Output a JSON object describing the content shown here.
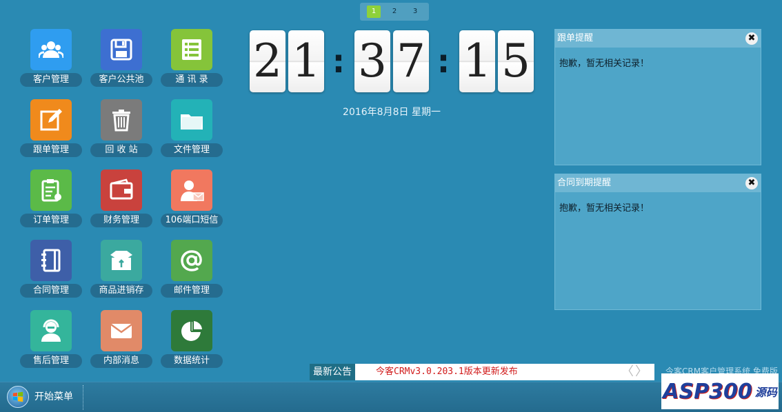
{
  "pager": {
    "pages": [
      "1",
      "2",
      "3"
    ],
    "active": 0
  },
  "desktop": {
    "icons": [
      {
        "label": "客户管理",
        "icon": "users-icon",
        "color": "#2f9df0"
      },
      {
        "label": "客户公共池",
        "icon": "floppy-disk-icon",
        "color": "#3d6fd1"
      },
      {
        "label": "通 讯 录",
        "icon": "list-icon",
        "color": "#85c43a"
      },
      {
        "label": "跟单管理",
        "icon": "edit-icon",
        "color": "#f08a1c"
      },
      {
        "label": "回 收 站",
        "icon": "trash-icon",
        "color": "#7b7b7b"
      },
      {
        "label": "文件管理",
        "icon": "folder-icon",
        "color": "#23b2b7"
      },
      {
        "label": "订单管理",
        "icon": "clipboard-icon",
        "color": "#5bba48"
      },
      {
        "label": "财务管理",
        "icon": "wallet-icon",
        "color": "#c9423d"
      },
      {
        "label": "106端口短信",
        "icon": "sms-person-icon",
        "color": "#f1785f"
      },
      {
        "label": "合同管理",
        "icon": "notebook-icon",
        "color": "#3e5fa8"
      },
      {
        "label": "商品进销存",
        "icon": "box-icon",
        "color": "#3ba99f"
      },
      {
        "label": "邮件管理",
        "icon": "at-sign-icon",
        "color": "#53a84e"
      },
      {
        "label": "售后管理",
        "icon": "support-agent-icon",
        "color": "#34b59b"
      },
      {
        "label": "内部消息",
        "icon": "envelope-icon",
        "color": "#e18a68"
      },
      {
        "label": "数据统计",
        "icon": "pie-chart-icon",
        "color": "#2e7a3a"
      }
    ]
  },
  "clock": {
    "h1": "2",
    "h2": "1",
    "m1": "3",
    "m2": "7",
    "s1": "1",
    "s2": "5",
    "sep": ":"
  },
  "date": "2016年8月8日  星期一",
  "panels": [
    {
      "title": "跟单提醒",
      "body": "抱歉，暂无相关记录！",
      "close": "✖"
    },
    {
      "title": "合同到期提醒",
      "body": "抱歉，暂无相关记录！",
      "close": "✖"
    }
  ],
  "notice": {
    "title": "最新公告",
    "text": "今客CRMv3.0.203.1版本更新发布",
    "prev": "〈",
    "next": "〉"
  },
  "footer": "今客CRM客户管理系统 免费版",
  "taskbar": {
    "start_label": "开始菜单"
  },
  "watermark": {
    "text": "ASP300",
    "suffix": "源码"
  }
}
